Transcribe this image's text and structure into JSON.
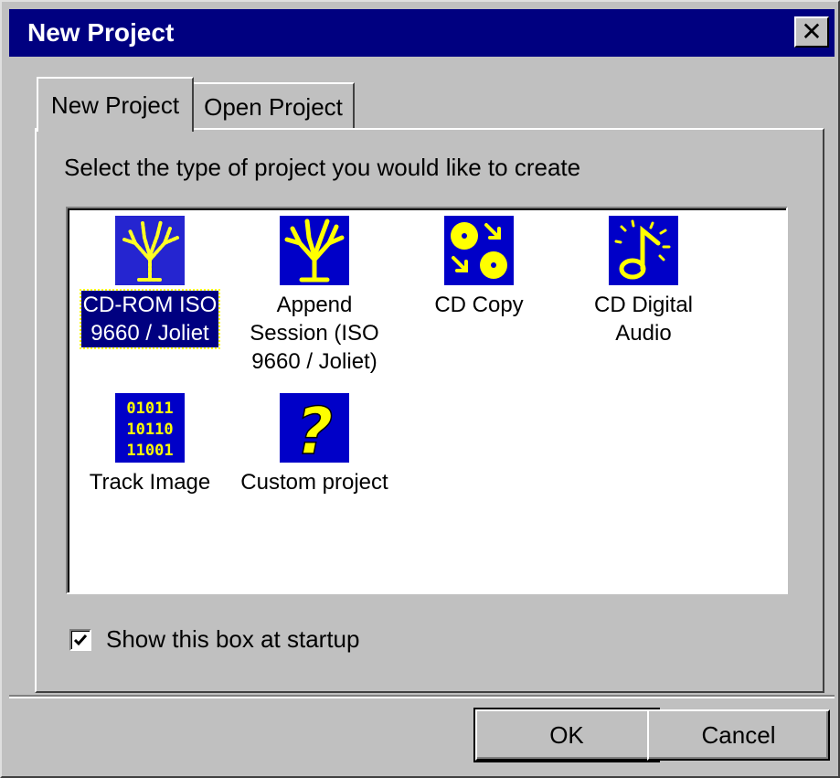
{
  "window": {
    "title": "New Project",
    "close_glyph": "✕",
    "title_color": "#000080"
  },
  "tabs": [
    {
      "label": "New Project",
      "active": true
    },
    {
      "label": "Open Project",
      "active": false
    }
  ],
  "prompt": "Select the type of project you would like to create",
  "projects": [
    {
      "label": "CD-ROM ISO\n9660 / Joliet",
      "icon": "tree-dotted-icon",
      "selected": true
    },
    {
      "label": "Append\nSession (ISO\n9660 / Joliet)",
      "icon": "tree-icon",
      "selected": false
    },
    {
      "label": "CD Copy",
      "icon": "cd-copy-icon",
      "selected": false
    },
    {
      "label": "CD Digital\nAudio",
      "icon": "music-note-icon",
      "selected": false
    },
    {
      "label": "Track Image",
      "icon": "binary-icon",
      "selected": false
    },
    {
      "label": "Custom project",
      "icon": "question-icon",
      "selected": false
    }
  ],
  "binary_icon_text": [
    "01011",
    "10110",
    "11001"
  ],
  "question_glyph": "?",
  "startup_checkbox": {
    "label": "Show this box at startup",
    "checked": true
  },
  "buttons": {
    "ok": "OK",
    "cancel": "Cancel"
  },
  "colors": {
    "icon_bg": "#0000c8",
    "icon_fg": "#ffff00"
  }
}
